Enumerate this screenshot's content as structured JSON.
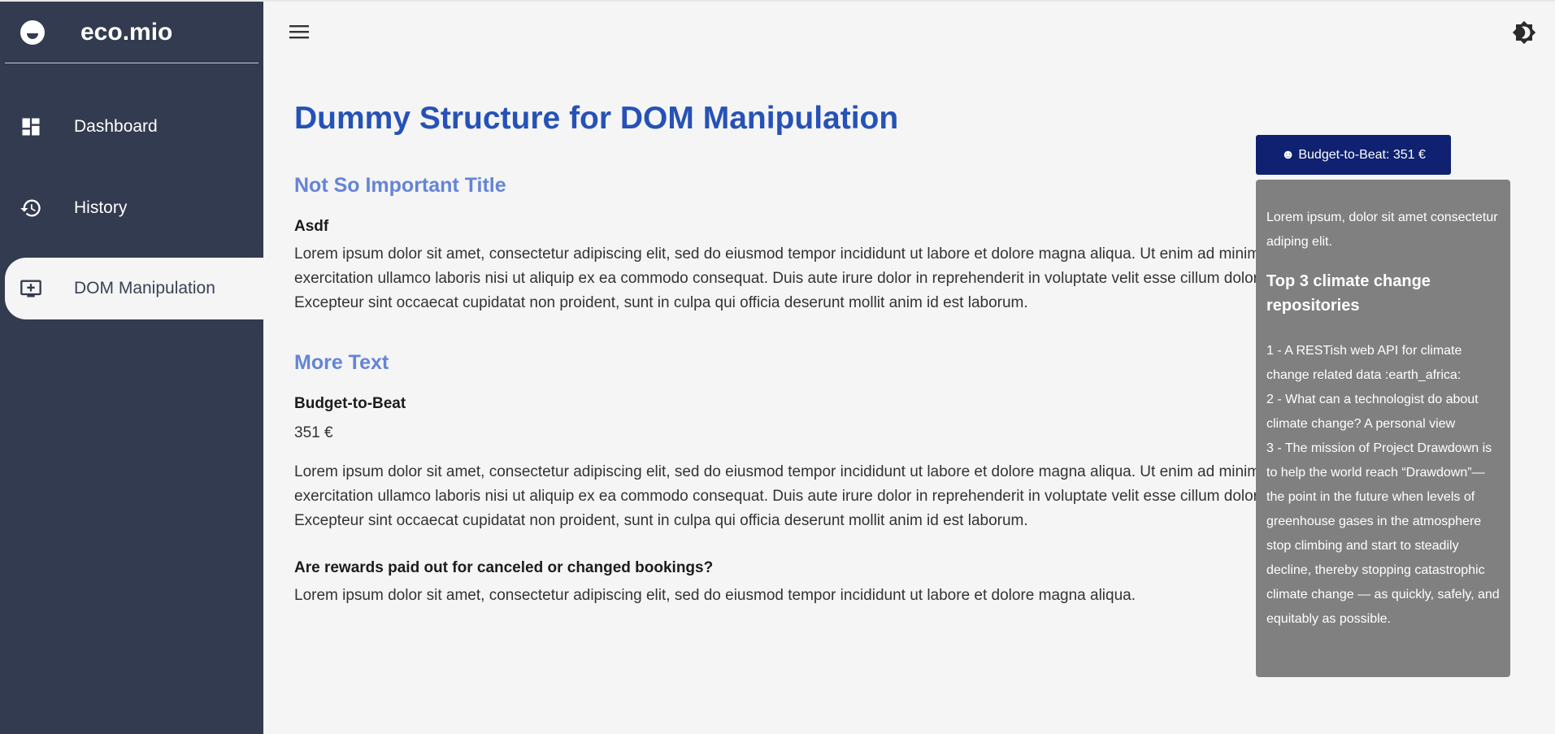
{
  "app": {
    "brand": "eco.mio"
  },
  "sidebar": {
    "items": [
      {
        "label": "Dashboard",
        "icon": "dashboard-icon"
      },
      {
        "label": "History",
        "icon": "history-icon"
      },
      {
        "label": "DOM Manipulation",
        "icon": "add-to-queue-icon",
        "active": true
      }
    ]
  },
  "header": {
    "menu_icon": "hamburger-icon",
    "theme_icon": "brightness-icon"
  },
  "main": {
    "title": "Dummy Structure for DOM Manipulation",
    "section1": {
      "title": "Not So Important Title",
      "subtitle": "Asdf",
      "paragraph": [
        "Lorem ipsum dolor sit amet, consectetur adipiscing elit, sed do eiusmod tempor incididunt ut labore et dolore magna aliqua. Ut enim ad minim veniam, quis nostrud",
        "exercitation ullamco laboris nisi ut aliquip ex ea commodo consequat. Duis aute irure dolor in reprehenderit in voluptate velit esse cillum dolore eu fugiat nulla pariatur.",
        "Excepteur sint occaecat cupidatat non proident, sunt in culpa qui officia deserunt mollit anim id est laborum."
      ]
    },
    "section2": {
      "title": "More Text",
      "budget_label": "Budget-to-Beat",
      "budget_value": "351 €",
      "paragraph": [
        "Lorem ipsum dolor sit amet, consectetur adipiscing elit, sed do eiusmod tempor incididunt ut labore et dolore magna aliqua. Ut enim ad minim veniam, quis nostrud",
        "exercitation ullamco laboris nisi ut aliquip ex ea commodo consequat. Duis aute irure dolor in reprehenderit in voluptate velit esse cillum dolore eu fugiat nulla pariatur.",
        "Excepteur sint occaecat cupidatat non proident, sunt in culpa qui officia deserunt mollit anim id est laborum."
      ],
      "question": "Are rewards paid out for canceled or changed bookings?",
      "answer": "Lorem ipsum dolor sit amet, consectetur adipiscing elit, sed do eiusmod tempor incididunt ut labore et dolore magna aliqua."
    }
  },
  "budget_panel": {
    "button_label": "☻ Budget-to-Beat: 351 €",
    "intro": "Lorem ipsum, dolor sit amet consectetur adiping elit.",
    "heading": "Top 3 climate change repositories",
    "items": [
      "1 - A RESTish web API for climate change related data :earth_africa:",
      "2 - What can a technologist do about climate change? A personal view",
      "3 - The mission of Project Drawdown is to help the world reach “Drawdown”— the point in the future when levels of greenhouse gases in the atmosphere stop climbing and start to steadily decline, thereby stopping catastrophic climate change — as quickly, safely, and equitably as possible."
    ]
  },
  "colors": {
    "sidebar_bg": "#323b4f",
    "page_bg": "#f5f5f5",
    "title": "#2652b7",
    "section_title": "#6584d8",
    "button_bg": "#0f2170",
    "panel_bg": "#808080"
  }
}
